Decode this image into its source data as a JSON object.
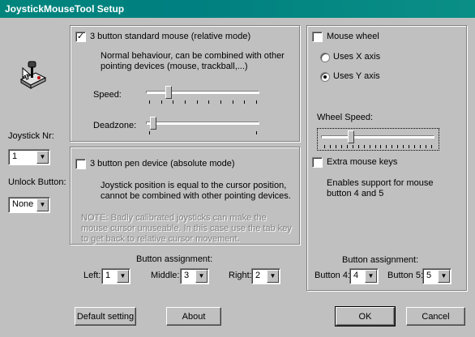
{
  "window": {
    "title": "JoystickMouseTool Setup"
  },
  "left": {
    "joystick_label": "Joystick Nr:",
    "joystick_value": "1",
    "unlock_label": "Unlock Button:",
    "unlock_value": "None"
  },
  "standard": {
    "checkbox_label": "3 button standard mouse (relative mode)",
    "checked": true,
    "description": "Normal behaviour, can be combined with other pointing devices (mouse, trackball,...)",
    "speed_label": "Speed:",
    "speed_level": 0.18,
    "deadzone_label": "Deadzone:",
    "deadzone_level": 0.04
  },
  "pen": {
    "checkbox_label": "3 button pen device (absolute mode)",
    "checked": false,
    "description": "Joystick position is equal to the cursor position, cannot be combined with other pointing devices.",
    "note": "NOTE: Badly calibrated joysticks can make the mouse cursor unuseable. In this case use the tab key to get back to relative cursor movement."
  },
  "assignment": {
    "title": "Button assignment:",
    "left_label": "Left:",
    "left_value": "1",
    "middle_label": "Middle:",
    "middle_value": "3",
    "right_label": "Right:",
    "right_value": "2"
  },
  "wheel": {
    "checkbox_label": "Mouse wheel",
    "checked": false,
    "radio_x": "Uses X axis",
    "radio_y": "Uses Y axis",
    "selected_axis": "y",
    "speed_label": "Wheel Speed:",
    "speed_level": 0.25,
    "extra_label": "Extra mouse keys",
    "extra_checked": false,
    "extra_desc": "Enables support for mouse button 4 and 5",
    "assign_title": "Button assignment:",
    "b4_label": "Button 4:",
    "b4_value": "4",
    "b5_label": "Button 5:",
    "b5_value": "5"
  },
  "buttons": {
    "default": "Default setting",
    "about": "About",
    "ok": "OK",
    "cancel": "Cancel"
  }
}
